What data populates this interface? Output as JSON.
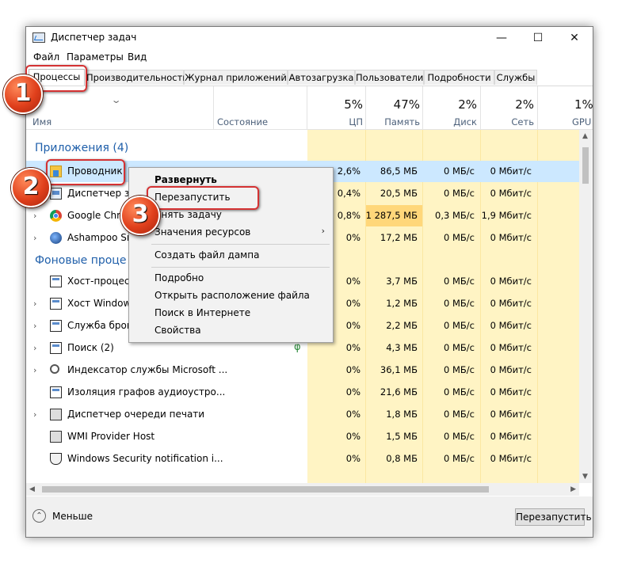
{
  "window": {
    "title": "Диспетчер задач",
    "minimize": "—",
    "maximize": "☐",
    "close": "✕"
  },
  "menu": [
    "Файл",
    "Параметры",
    "Вид"
  ],
  "tabs": [
    "Процессы",
    "Производительность",
    "Журнал приложений",
    "Автозагрузка",
    "Пользователи",
    "Подробности",
    "Службы"
  ],
  "columns": {
    "name": "Имя",
    "status": "Состояние",
    "cpu": {
      "pct": "5%",
      "label": "ЦП"
    },
    "memory": {
      "pct": "47%",
      "label": "Память"
    },
    "disk": {
      "pct": "2%",
      "label": "Диск"
    },
    "network": {
      "pct": "2%",
      "label": "Сеть"
    },
    "gpu": {
      "pct": "1%",
      "label": "GPU"
    }
  },
  "groups": {
    "apps": "Приложения (4)",
    "background": "Фоновые проце"
  },
  "apps": [
    {
      "name": "Проводник",
      "icon": "explorer-icon",
      "cpu": "2,6%",
      "mem": "86,5 МБ",
      "disk": "0 МБ/с",
      "net": "0 Мбит/с"
    },
    {
      "name": "Диспетчер зад",
      "icon": "task-manager-icon",
      "cpu": "0,4%",
      "mem": "20,5 МБ",
      "disk": "0 МБ/с",
      "net": "0 Мбит/с"
    },
    {
      "name": "Google Chrom",
      "icon": "chrome-icon",
      "cpu": "0,8%",
      "mem": "1 287,5 МБ",
      "disk": "0,3 МБ/с",
      "net": "1,9 Мбит/с"
    },
    {
      "name": "Ashampoo Sna",
      "icon": "ashampoo-icon",
      "cpu": "0%",
      "mem": "17,2 МБ",
      "disk": "0 МБ/с",
      "net": "0 Мбит/с"
    }
  ],
  "background": [
    {
      "name": "Хост-процесс",
      "icon": "host-process-icon",
      "cpu": "0%",
      "mem": "3,7 МБ",
      "disk": "0 МБ/с",
      "net": "0 Мбит/с"
    },
    {
      "name": "Хост Windows",
      "icon": "window-host-icon",
      "cpu": "0%",
      "mem": "1,2 МБ",
      "disk": "0 МБ/с",
      "net": "0 Мбит/с"
    },
    {
      "name": "Служба броке",
      "icon": "broker-service-icon",
      "cpu": "0%",
      "mem": "2,2 МБ",
      "disk": "0 МБ/с",
      "net": "0 Мбит/с"
    },
    {
      "name": "Поиск (2)",
      "icon": "search-icon",
      "cpu": "0%",
      "mem": "4,3 МБ",
      "disk": "0 МБ/с",
      "net": "0 Мбит/с"
    },
    {
      "name": "Индексатор службы Microsoft ...",
      "icon": "indexer-icon",
      "cpu": "0%",
      "mem": "36,1 МБ",
      "disk": "0 МБ/с",
      "net": "0 Мбит/с"
    },
    {
      "name": "Изоляция графов аудиоустро...",
      "icon": "audio-graph-icon",
      "cpu": "0%",
      "mem": "21,6 МБ",
      "disk": "0 МБ/с",
      "net": "0 Мбит/с"
    },
    {
      "name": "Диспетчер очереди печати",
      "icon": "printer-icon",
      "cpu": "0%",
      "mem": "1,8 МБ",
      "disk": "0 МБ/с",
      "net": "0 Мбит/с"
    },
    {
      "name": "WMI Provider Host",
      "icon": "wmi-icon",
      "cpu": "0%",
      "mem": "1,5 МБ",
      "disk": "0 МБ/с",
      "net": "0 Мбит/с"
    },
    {
      "name": "Windows Security notification i...",
      "icon": "shield-icon",
      "cpu": "0%",
      "mem": "0,8 МБ",
      "disk": "0 МБ/с",
      "net": "0 Мбит/с"
    }
  ],
  "context_menu": {
    "items": [
      "Развернуть",
      "Перезапустить",
      "Снять задачу",
      "Значения ресурсов",
      "Создать файл дампа",
      "Подробно",
      "Открыть расположение файла",
      "Поиск в Интернете",
      "Свойства"
    ],
    "submenu_arrow": "›"
  },
  "footer": {
    "less": "Меньше",
    "action_button": "Перезапустить"
  },
  "annotations": {
    "badges": [
      "1",
      "2",
      "3"
    ],
    "accent": "#d43233"
  }
}
